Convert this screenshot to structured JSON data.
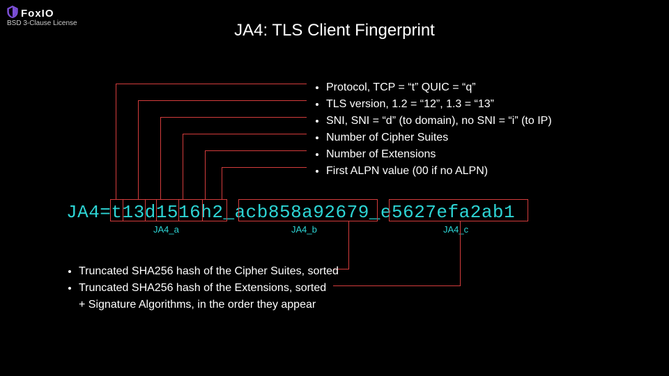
{
  "logo": {
    "name": "FoxIO"
  },
  "license": "BSD 3-Clause License",
  "title": "JA4: TLS Client Fingerprint",
  "top_bullets": [
    "Protocol, TCP = “t”  QUIC = “q”",
    "TLS version, 1.2 = “12”, 1.3 = “13”",
    "SNI, SNI = “d” (to domain), no SNI = “i” (to IP)",
    "Number of Cipher Suites",
    "Number of Extensions",
    "First ALPN value (00 if no ALPN)"
  ],
  "fingerprint": {
    "prefix": "JA4=",
    "a": "t13d1516h2",
    "b": "acb858a92679",
    "c": "e5627efa2ab1",
    "sep": "_",
    "label_a": "JA4_a",
    "label_b": "JA4_b",
    "label_c": "JA4_c"
  },
  "bottom_bullets": [
    "Truncated SHA256 hash of the Cipher Suites, sorted",
    "Truncated SHA256 hash of the Extensions, sorted",
    "+ Signature Algorithms, in the order they appear"
  ],
  "colors": {
    "cyan": "#2dd4d4",
    "red": "#d43c3c",
    "purple": "#7b4fd6"
  }
}
